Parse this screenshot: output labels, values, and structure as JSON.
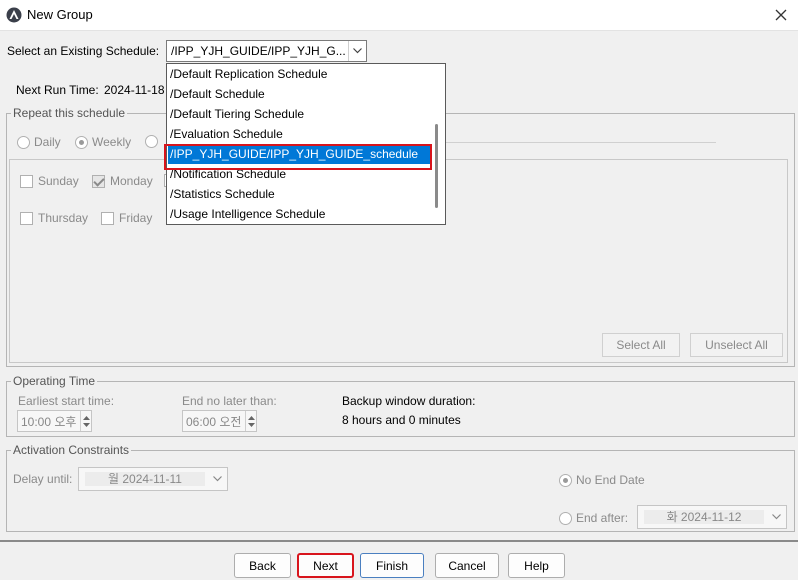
{
  "window": {
    "title": "New Group"
  },
  "schedule": {
    "label": "Select an Existing Schedule:",
    "selected": "/IPP_YJH_GUIDE/IPP_YJH_G...",
    "next_run_label": "Next Run Time:",
    "next_run_value": "2024-11-18",
    "options": [
      "/Default Replication Schedule",
      "/Default Schedule",
      "/Default Tiering Schedule",
      "/Evaluation Schedule",
      "/IPP_YJH_GUIDE/IPP_YJH_GUIDE_schedule",
      "/Notification Schedule",
      "/Statistics Schedule",
      "/Usage Intelligence Schedule"
    ],
    "highlighted_index": 4
  },
  "repeat": {
    "legend": "Repeat this schedule",
    "daily": "Daily",
    "weekly": "Weekly",
    "days": [
      "Sunday",
      "Monday",
      "Thursday",
      "Friday"
    ],
    "select_all": "Select All",
    "unselect_all": "Unselect All"
  },
  "operating": {
    "legend": "Operating Time",
    "earliest_label": "Earliest start time:",
    "earliest_value": "10:00 오후",
    "end_label": "End no later than:",
    "end_value": "06:00 오전",
    "duration_label": "Backup window duration:",
    "duration_value": "8 hours and 0 minutes"
  },
  "activation": {
    "legend": "Activation Constraints",
    "delay_label": "Delay until:",
    "delay_value": "월 2024-11-11",
    "no_end_label": "No End Date",
    "end_after_label": "End after:",
    "end_after_value": "화 2024-11-12"
  },
  "buttons": {
    "back": "Back",
    "next": "Next",
    "finish": "Finish",
    "cancel": "Cancel",
    "help": "Help"
  },
  "colors": {
    "selection": "#0078d7",
    "highlight_box": "#d8141c"
  }
}
